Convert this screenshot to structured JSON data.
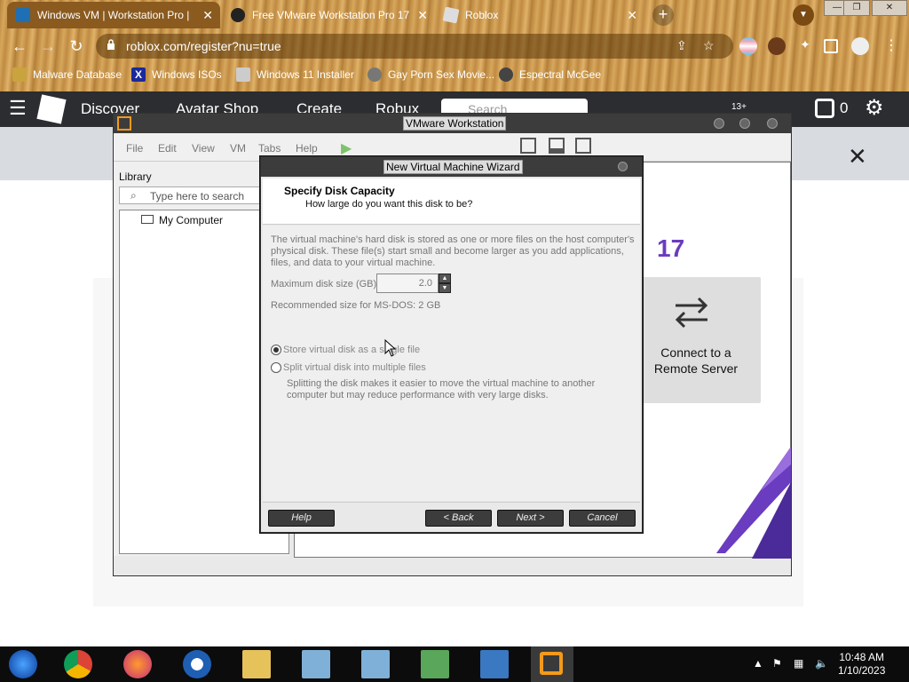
{
  "browser": {
    "tabs": [
      {
        "title": "Windows VM | Workstation Pro |",
        "favicon": "vmware-icon",
        "active": true
      },
      {
        "title": "Free VMware Workstation Pro 17",
        "favicon": "github-icon",
        "active": false
      },
      {
        "title": "Roblox",
        "favicon": "roblox-icon",
        "active": false
      }
    ],
    "url": "roblox.com/register?nu=true",
    "bookmarks": [
      "Malware Database",
      "Windows ISOs",
      "Windows 11 Installer",
      "Gay Porn Sex Movie...",
      "Espectral McGee"
    ]
  },
  "roblox": {
    "nav": [
      "Discover",
      "Avatar Shop",
      "Create",
      "Robux"
    ],
    "search_placeholder": "Search",
    "age_badge": "13+",
    "robux_count": "0"
  },
  "vmware": {
    "title": "VMware Workstation",
    "menu": [
      "File",
      "Edit",
      "View",
      "VM",
      "Tabs",
      "Help"
    ],
    "library_title": "Library",
    "library_search_placeholder": "Type here to search",
    "library_items": [
      "My Computer"
    ],
    "home_version": "17",
    "tile_label_line1": "Connect to a",
    "tile_label_line2": "Remote Server"
  },
  "wizard": {
    "title": "New Virtual Machine Wizard",
    "heading": "Specify Disk Capacity",
    "subheading": "How large do you want this disk to be?",
    "description": "The virtual machine's hard disk is stored as one or more files on the host computer's physical disk. These file(s) start small and become larger as you add applications, files, and data to your virtual machine.",
    "size_label": "Maximum disk size (GB):",
    "size_value": "2.0",
    "recommended": "Recommended size for MS-DOS: 2 GB",
    "option_single": "Store virtual disk as a single file",
    "option_split": "Split virtual disk into multiple files",
    "split_description": "Splitting the disk makes it easier to move the virtual machine to another computer but may reduce performance with very large disks.",
    "buttons": {
      "help": "Help",
      "back": "< Back",
      "next": "Next >",
      "cancel": "Cancel"
    }
  },
  "taskbar": {
    "time": "10:48 AM",
    "date": "1/10/2023"
  }
}
